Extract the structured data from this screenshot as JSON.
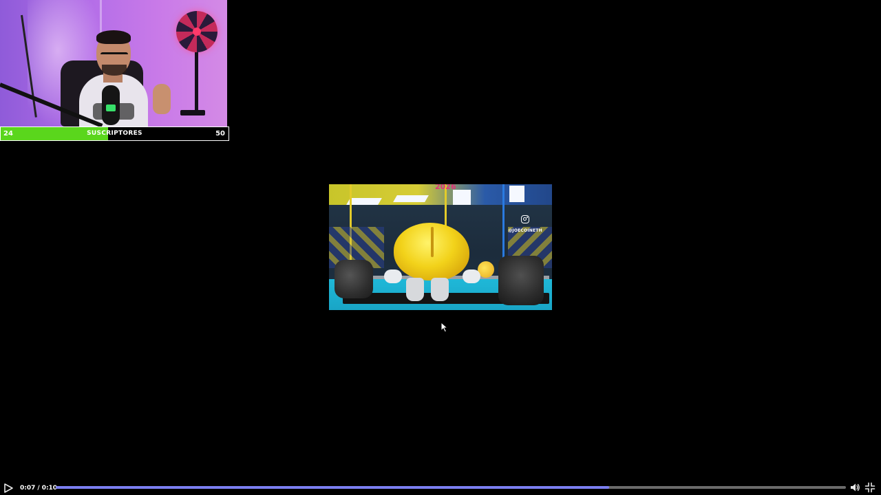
{
  "overlay": {
    "subscriber_goal": {
      "current": "24",
      "label": "SUSCRIPTORES",
      "goal": "50",
      "progress_fraction": 0.47,
      "fill_color": "#5ad61c"
    }
  },
  "clip": {
    "year_text": "2026",
    "social_icon": "instagram-icon",
    "social_handle": "@JOECOINETH"
  },
  "player": {
    "state": "paused",
    "current_time": "0:07",
    "separator": "/",
    "duration": "0:10",
    "progress_fraction": 0.7,
    "played_color": "#7b7ff0",
    "icons": {
      "play": "play-icon",
      "volume": "volume-icon",
      "fullscreen": "exit-fullscreen-icon"
    }
  }
}
